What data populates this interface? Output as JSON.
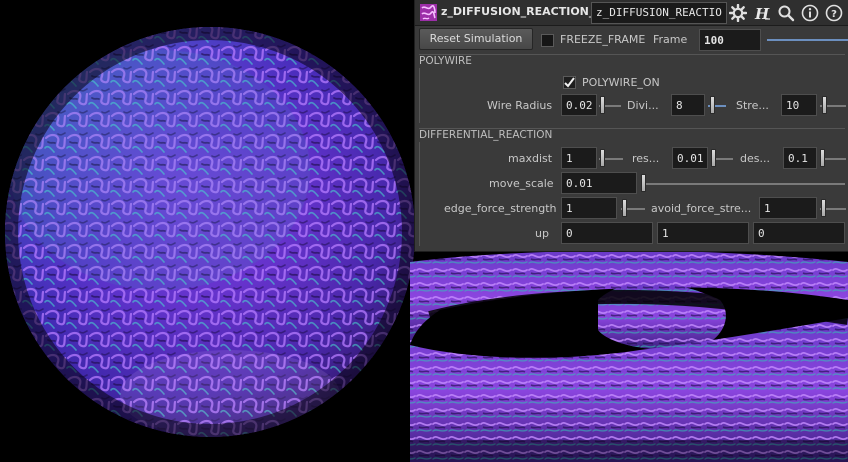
{
  "node": {
    "name": "z_DIFFUSION_REACTION_...",
    "path": "z_DIFFUSION_REACTIO",
    "icons": [
      "node-type-icon",
      "gear-icon",
      "houdini-help-icon",
      "search-icon",
      "info-icon",
      "help-icon"
    ]
  },
  "toolbar": {
    "reset_label": "Reset Simulation",
    "freeze_label": "FREEZE_FRAME",
    "freeze_checked": false,
    "frame_label": "Frame",
    "frame_value": "100"
  },
  "polywire": {
    "section_title": "POLYWIRE",
    "toggle_label": "POLYWIRE_ON",
    "toggle_checked": true,
    "wire_radius_label": "Wire Radius",
    "wire_radius_value": "0.02",
    "divisions_label": "Divi...",
    "divisions_value": "8",
    "stretch_label": "Stre...",
    "stretch_value": "10"
  },
  "differential": {
    "section_title": "DIFFERENTIAL_REACTION",
    "maxdist_label": "maxdist",
    "maxdist_value": "1",
    "res_label": "res...",
    "res_value": "0.01",
    "des_label": "des...",
    "des_value": "0.1",
    "move_scale_label": "move_scale",
    "move_scale_value": "0.01",
    "edge_force_label": "edge_force_strength",
    "edge_force_value": "1",
    "avoid_force_label": "avoid_force_stre...",
    "avoid_force_value": "1",
    "up_label": "up",
    "up_x": "0",
    "up_y": "1",
    "up_z": "0"
  },
  "colors": {
    "panel_bg": "#3a3a3a",
    "field_bg": "#1b1b1b",
    "render_purple": "#7b3fd6",
    "render_teal": "#2fc6b4",
    "render_blue": "#3a3ad0",
    "slider_accent": "#6c8fbf"
  }
}
